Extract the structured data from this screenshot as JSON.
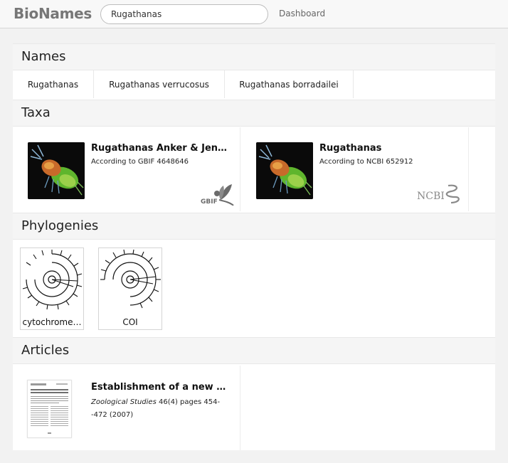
{
  "header": {
    "brand": "BioNames",
    "search_value": "Rugathanas",
    "nav_dashboard": "Dashboard"
  },
  "sections": {
    "names": "Names",
    "taxa": "Taxa",
    "phylogenies": "Phylogenies",
    "articles": "Articles"
  },
  "names": [
    "Rugathanas",
    "Rugathanas verrucosus",
    "Rugathanas borradailei"
  ],
  "taxa": [
    {
      "title": "Rugathanas Anker & Jen…",
      "subtitle": "According to GBIF 4648646",
      "source_logo": "gbif-logo",
      "logo_text": "GBIF"
    },
    {
      "title": "Rugathanas",
      "subtitle": "According to NCBI 652912",
      "source_logo": "ncbi-logo",
      "logo_text": "NCBI"
    }
  ],
  "phylogenies": [
    {
      "label": "cytochrome…"
    },
    {
      "label": "COI"
    }
  ],
  "articles": [
    {
      "title": "Establishment of a new …",
      "journal": "Zoological Studies",
      "details": " 46(4) pages 454-",
      "details2": "-472 (2007)"
    }
  ],
  "colors": {
    "page_bg": "#f2f2f2",
    "panel_bg": "#ffffff",
    "section_header_bg": "#f5f5f5",
    "gbif_green": "#4f9a3a",
    "ncbi_gray": "#8a8a8a"
  }
}
